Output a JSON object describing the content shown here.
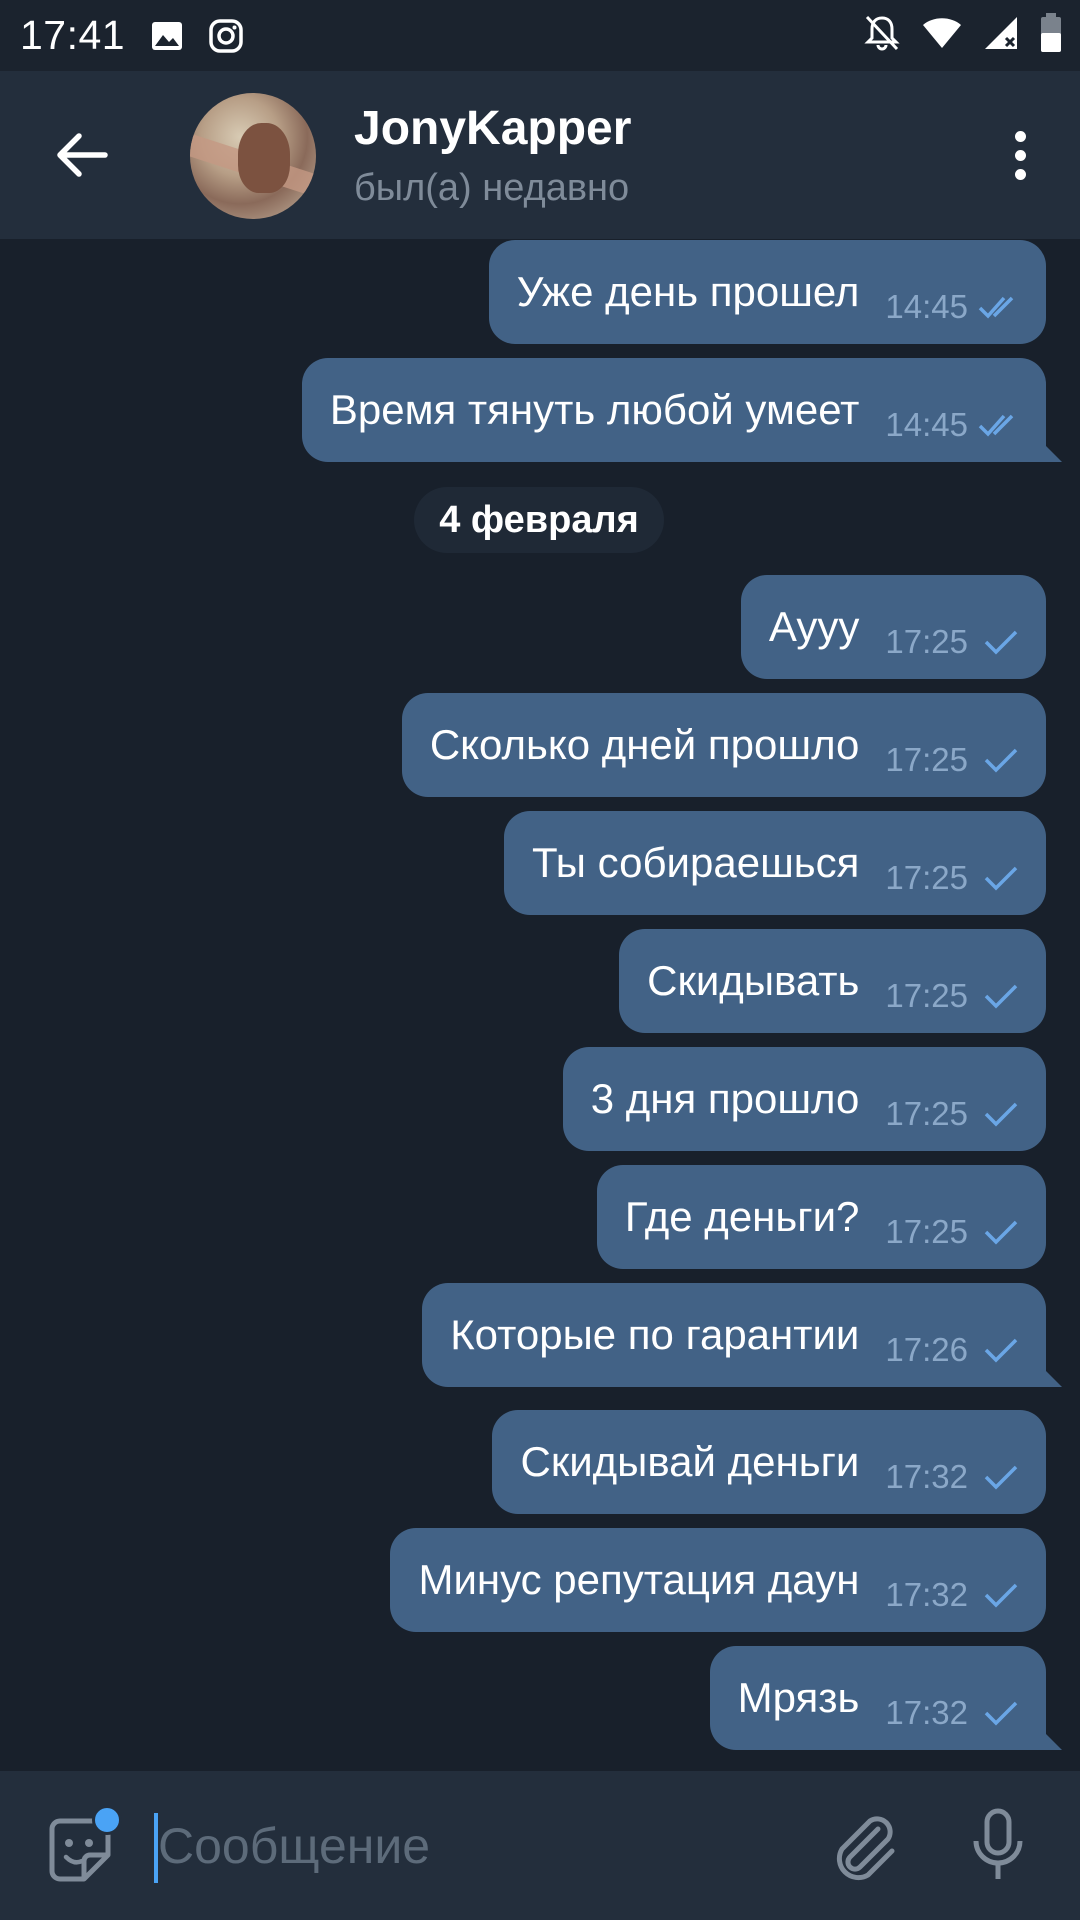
{
  "status_bar": {
    "time": "17:41",
    "icons": [
      "image-icon",
      "instagram-icon",
      "notifications-off-icon",
      "wifi-icon",
      "signal-icon",
      "battery-icon"
    ]
  },
  "header": {
    "name": "JonyKapper",
    "status": "был(а) недавно",
    "icons": [
      "back-arrow-icon",
      "more-vertical-icon"
    ]
  },
  "messages": [
    {
      "text": "Уже день прошел",
      "time": "14:45",
      "status": "read"
    },
    {
      "text": "Время тянуть любой умеет",
      "time": "14:45",
      "status": "read"
    },
    {
      "text": "Аууу",
      "time": "17:25",
      "status": "sent"
    },
    {
      "text": "Сколько дней прошло",
      "time": "17:25",
      "status": "sent"
    },
    {
      "text": "Ты собираешься",
      "time": "17:25",
      "status": "sent"
    },
    {
      "text": "Скидывать",
      "time": "17:25",
      "status": "sent"
    },
    {
      "text": "3 дня прошло",
      "time": "17:25",
      "status": "sent"
    },
    {
      "text": "Где деньги?",
      "time": "17:25",
      "status": "sent"
    },
    {
      "text": "Которые по гарантии",
      "time": "17:26",
      "status": "sent"
    },
    {
      "text": "Скидывай деньги",
      "time": "17:32",
      "status": "sent"
    },
    {
      "text": "Минус репутация даун",
      "time": "17:32",
      "status": "sent"
    },
    {
      "text": "Мрязь",
      "time": "17:32",
      "status": "sent"
    }
  ],
  "date_separator": "4 февраля",
  "input": {
    "placeholder": "Сообщение",
    "icons": [
      "sticker-icon",
      "attach-icon",
      "mic-icon"
    ]
  },
  "colors": {
    "background": "#18202b",
    "header": "#232e3c",
    "bubble_out": "#426286",
    "meta": "#8ba8c8",
    "accent": "#4aa3f5"
  }
}
